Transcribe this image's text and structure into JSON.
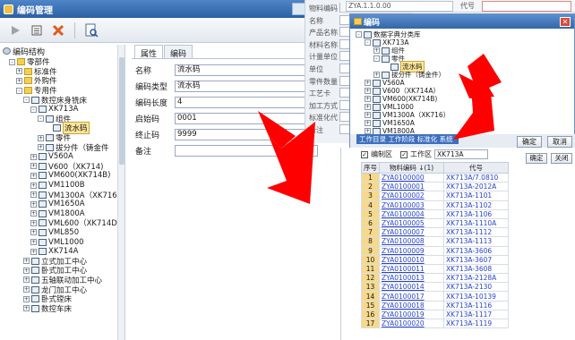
{
  "left_window": {
    "title": "编码管理",
    "tree_header": "编码结构",
    "tree": [
      {
        "label": "零部件",
        "level": 1,
        "kind": "folder",
        "exp": "-"
      },
      {
        "label": "标准件",
        "level": 2,
        "kind": "folder",
        "exp": "+"
      },
      {
        "label": "外购件",
        "level": 2,
        "kind": "folder",
        "exp": "+"
      },
      {
        "label": "专用件",
        "level": 2,
        "kind": "folder",
        "exp": "-"
      },
      {
        "label": "数控床身铣床",
        "level": 3,
        "kind": "doc",
        "exp": "-"
      },
      {
        "label": "XK713A",
        "level": 4,
        "kind": "doc",
        "exp": "-"
      },
      {
        "label": "组件",
        "level": 5,
        "kind": "doc",
        "exp": "-"
      },
      {
        "label": "流水码",
        "level": 6,
        "kind": "doc",
        "exp": "",
        "selected": true
      },
      {
        "label": "零件",
        "level": 5,
        "kind": "doc",
        "exp": "+"
      },
      {
        "label": "拔分件（铸金件",
        "level": 5,
        "kind": "doc",
        "exp": "+"
      },
      {
        "label": "V560A",
        "level": 4,
        "kind": "doc",
        "exp": "+"
      },
      {
        "label": "V600（XK714)",
        "level": 4,
        "kind": "doc",
        "exp": "+"
      },
      {
        "label": "VM600(XK714B)",
        "level": 4,
        "kind": "doc",
        "exp": "+"
      },
      {
        "label": "VM1100B",
        "level": 4,
        "kind": "doc",
        "exp": "+"
      },
      {
        "label": "VM1300A（XK716",
        "level": 4,
        "kind": "doc",
        "exp": "+"
      },
      {
        "label": "VM1650A",
        "level": 4,
        "kind": "doc",
        "exp": "+"
      },
      {
        "label": "VM1800A",
        "level": 4,
        "kind": "doc",
        "exp": "+"
      },
      {
        "label": "VML600（XK714D",
        "level": 4,
        "kind": "doc",
        "exp": "+"
      },
      {
        "label": "VML850",
        "level": 4,
        "kind": "doc",
        "exp": "+"
      },
      {
        "label": "VML1000",
        "level": 4,
        "kind": "doc",
        "exp": "+"
      },
      {
        "label": "XK714A",
        "level": 4,
        "kind": "doc",
        "exp": "+"
      },
      {
        "label": "立式加工中心",
        "level": 3,
        "kind": "doc",
        "exp": "+"
      },
      {
        "label": "卧式加工中心",
        "level": 3,
        "kind": "doc",
        "exp": "+"
      },
      {
        "label": "五轴联动加工中心",
        "level": 3,
        "kind": "doc",
        "exp": "+"
      },
      {
        "label": "龙门加工中心",
        "level": 3,
        "kind": "doc",
        "exp": "+"
      },
      {
        "label": "卧式镗床",
        "level": 3,
        "kind": "doc",
        "exp": "+"
      },
      {
        "label": "数控车床",
        "level": 3,
        "kind": "doc",
        "exp": "+"
      }
    ],
    "tabs": [
      "属性",
      "编码"
    ],
    "form": [
      {
        "label": "名称",
        "value": "流水码"
      },
      {
        "label": "编码类型",
        "value": "流水码"
      },
      {
        "label": "编码长度",
        "value": "4"
      },
      {
        "label": "启始码",
        "value": "0001"
      },
      {
        "label": "终止码",
        "value": "9999"
      },
      {
        "label": "备注",
        "value": ""
      }
    ]
  },
  "middle_form": {
    "rows": [
      "物料编码",
      "名称",
      "产品名称",
      "材料名称",
      "计量单位",
      "单位",
      "零件数量",
      "工艺卡",
      "加工方式",
      "标准化代",
      "备注"
    ]
  },
  "top_strip": {
    "code_value": "ZYA.1.1.0.00",
    "label": "代号"
  },
  "code_dialog": {
    "title": "编码",
    "tree": [
      {
        "label": "数据字典分类库",
        "level": 0,
        "exp": "-"
      },
      {
        "label": "XK713A",
        "level": 1,
        "exp": "-"
      },
      {
        "label": "组件",
        "level": 2,
        "exp": "+"
      },
      {
        "label": "零件",
        "level": 2,
        "exp": "-"
      },
      {
        "label": "流水码",
        "level": 3,
        "exp": "",
        "selected": true
      },
      {
        "label": "拔分件（铸金件）",
        "level": 2,
        "exp": "+"
      },
      {
        "label": "V560A",
        "level": 1,
        "exp": "+"
      },
      {
        "label": "V600（XK714A）",
        "level": 1,
        "exp": "+"
      },
      {
        "label": "VM600(XK714B)",
        "level": 1,
        "exp": "+"
      },
      {
        "label": "VML1000",
        "level": 1,
        "exp": "+"
      },
      {
        "label": "VM1300A（XK716）",
        "level": 1,
        "exp": "+"
      },
      {
        "label": "VM1650A",
        "level": 1,
        "exp": "+"
      },
      {
        "label": "VM1800A",
        "level": 1,
        "exp": "+"
      }
    ],
    "ok_label": "确定",
    "cancel_label": "取消",
    "info_text": "工作目录 工作阶段 标准化 系统"
  },
  "grid": {
    "filter_zone_label": "编制区",
    "filter_work_label": "工作区",
    "filter_value": "XK713A",
    "confirm_label": "确定",
    "close_label": "关闭",
    "headers": [
      "序号",
      "物料编码 ↓(1)",
      "代号"
    ],
    "rows": [
      [
        "1",
        "ZYA0100000",
        "XK713A/7.0810"
      ],
      [
        "2",
        "ZYA0100001",
        "XK713A-2012A"
      ],
      [
        "3",
        "ZYA0100002",
        "XK713A-1101"
      ],
      [
        "4",
        "ZYA0100003",
        "XK713A-1102"
      ],
      [
        "5",
        "ZYA0100004",
        "XK713A-1106"
      ],
      [
        "6",
        "ZYA0100005",
        "XK713A-1110A"
      ],
      [
        "7",
        "ZYA0100007",
        "XK713A-1112"
      ],
      [
        "8",
        "ZYA0100008",
        "XK713A-1113"
      ],
      [
        "9",
        "ZYA0100009",
        "XK713A-3606"
      ],
      [
        "10",
        "ZYA0100010",
        "XK713A-3607"
      ],
      [
        "11",
        "ZYA0100011",
        "XK713A-3608"
      ],
      [
        "12",
        "ZYA0100013",
        "XK713A-2128A"
      ],
      [
        "13",
        "ZYA0100014",
        "XK713A-2130"
      ],
      [
        "14",
        "ZYA0100017",
        "XK713A-10139"
      ],
      [
        "15",
        "ZYA0100018",
        "XK713A-1116"
      ],
      [
        "16",
        "ZYA0100019",
        "XK713A-1117"
      ],
      [
        "17",
        "ZYA0100020",
        "XK713A-1119"
      ]
    ]
  }
}
